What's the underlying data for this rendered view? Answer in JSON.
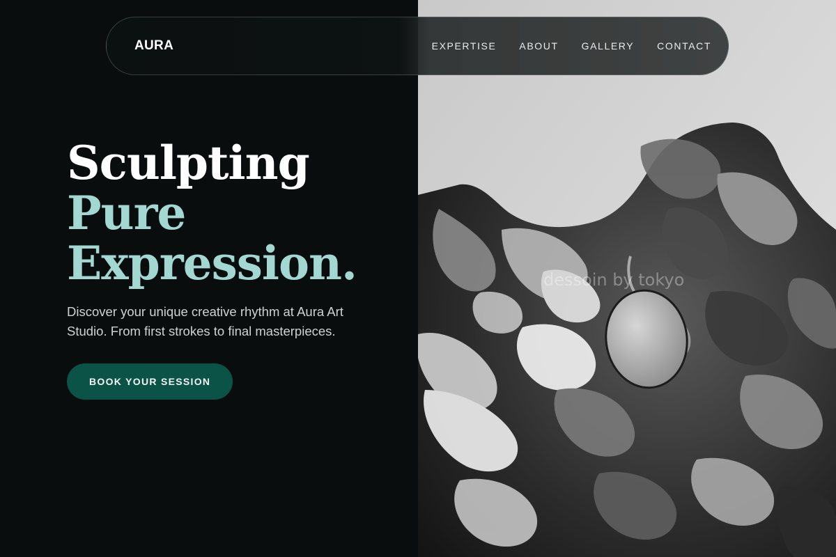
{
  "navbar": {
    "brand": "AURA",
    "links": [
      "EXPERTISE",
      "ABOUT",
      "GALLERY",
      "CONTACT"
    ]
  },
  "hero": {
    "headline_line1": "Sculpting",
    "headline_line2": "Pure",
    "headline_line3": "Expression.",
    "description": "Discover your unique creative rhythm at Aura Art Studio. From first strokes to final masterpieces.",
    "cta_label": "BOOK YOUR SESSION"
  },
  "image": {
    "watermark": "dessoin by tokyo",
    "subject": "monochrome paint palette with thick paint strokes hanging on a white wall"
  },
  "colors": {
    "background": "#0a0d0d",
    "accent_text": "#a3d8d2",
    "button": "#0b5247",
    "navbar_border": "#4a5c58"
  }
}
